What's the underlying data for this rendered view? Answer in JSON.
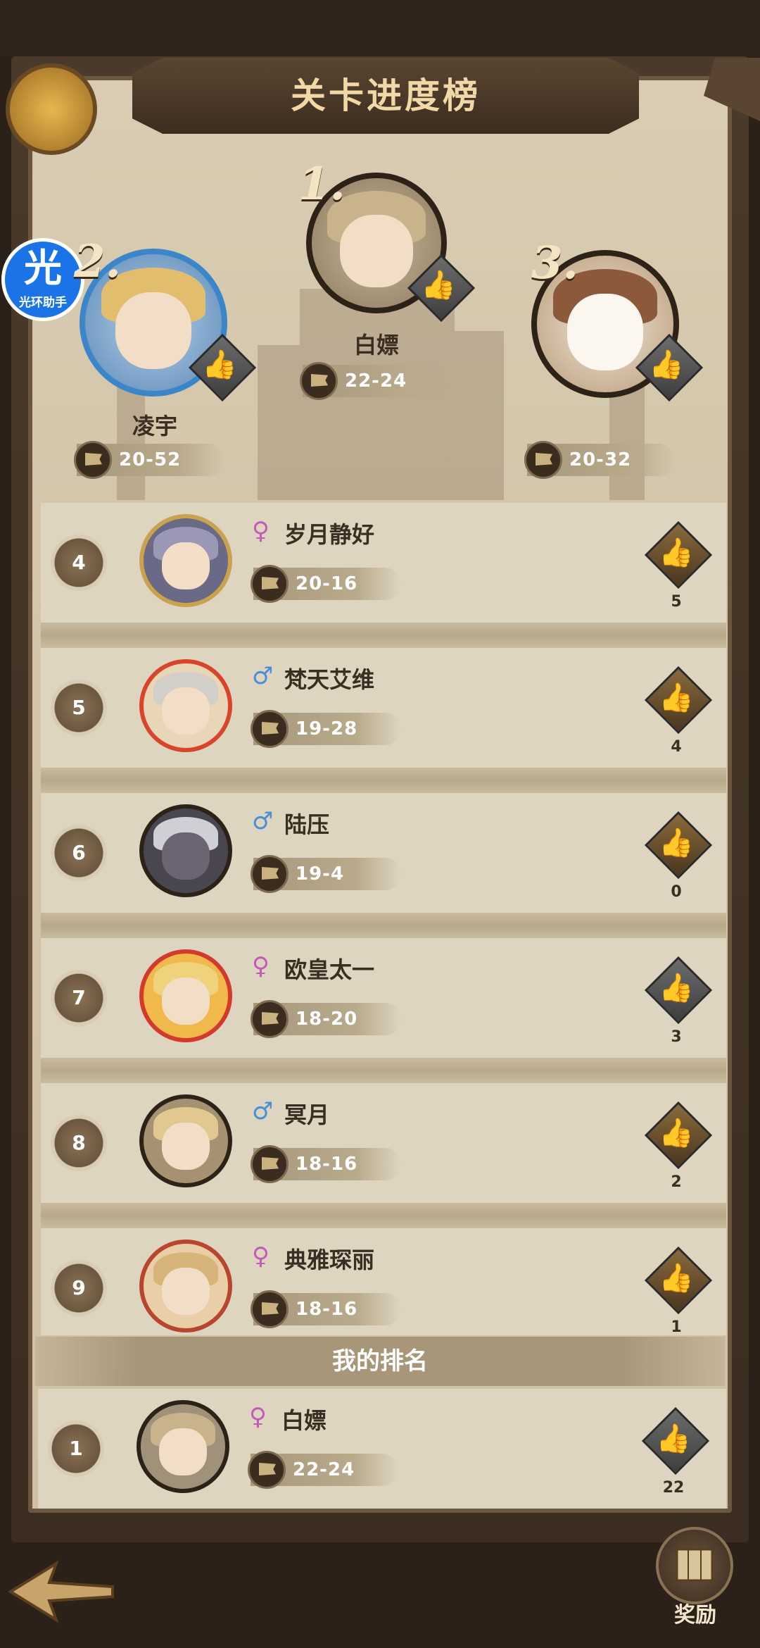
{
  "title": "关卡进度榜",
  "assistant_badge": {
    "glyph": "光",
    "label": "光环助手"
  },
  "podium": [
    {
      "rank": "1.",
      "name": "白嫖",
      "progress": "22-24"
    },
    {
      "rank": "2.",
      "name": "凌宇",
      "progress": "20-52"
    },
    {
      "rank": "3.",
      "name": "",
      "progress": "20-32"
    }
  ],
  "rows": [
    {
      "rank": "4",
      "gender": "♀",
      "name": "岁月静好",
      "progress": "20-16",
      "likes": "5"
    },
    {
      "rank": "5",
      "gender": "♂",
      "name": "梵天艾维",
      "progress": "19-28",
      "likes": "4"
    },
    {
      "rank": "6",
      "gender": "♂",
      "name": "陆压",
      "progress": "19-4",
      "likes": "0"
    },
    {
      "rank": "7",
      "gender": "♀",
      "name": "欧皇太一",
      "progress": "18-20",
      "likes": "3"
    },
    {
      "rank": "8",
      "gender": "♂",
      "name": "冥月",
      "progress": "18-16",
      "likes": "2"
    },
    {
      "rank": "9",
      "gender": "♀",
      "name": "典雅琛丽",
      "progress": "18-16",
      "likes": "1"
    }
  ],
  "my_rank": {
    "header": "我的排名",
    "rank": "1",
    "gender": "♀",
    "name": "白嫖",
    "progress": "22-24",
    "likes": "22"
  },
  "reward_label": "奖励",
  "icons": {
    "like": "thumbs-up-icon",
    "flag": "flag-icon",
    "back": "back-arrow-icon",
    "reward": "map-icon"
  },
  "colors": {
    "female": "#c35ab7",
    "male": "#4a8fd6",
    "title": "#f0d9a6"
  }
}
